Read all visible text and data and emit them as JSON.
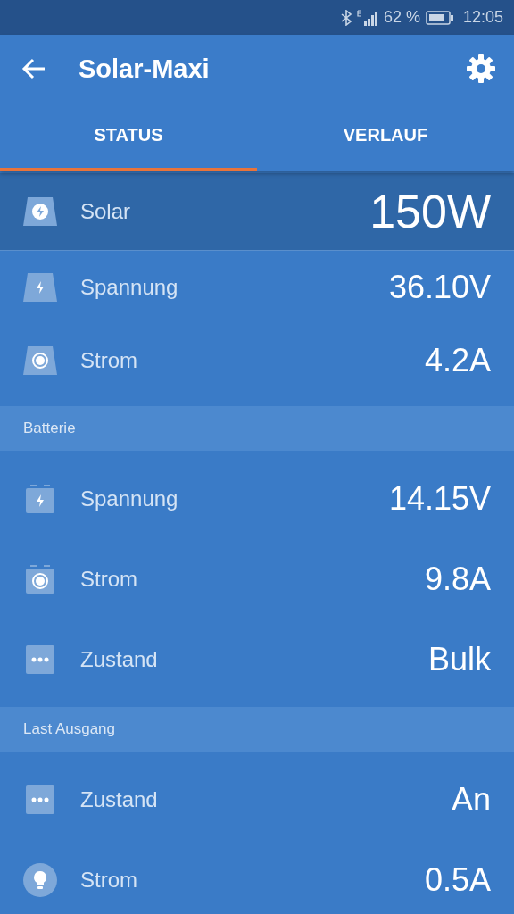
{
  "status_bar": {
    "battery_percent": "62 %",
    "time": "12:05"
  },
  "app_bar": {
    "title": "Solar-Maxi"
  },
  "tabs": [
    {
      "label": "STATUS",
      "selected": true
    },
    {
      "label": "VERLAUF",
      "selected": false
    }
  ],
  "sections": [
    {
      "rows": [
        {
          "kind": "panel-bolt-circle",
          "label": "Solar",
          "value": "150W",
          "emphasized": true
        },
        {
          "kind": "panel-bolt",
          "label": "Spannung",
          "value": "36.10V",
          "emphasized": false
        },
        {
          "kind": "panel-dot",
          "label": "Strom",
          "value": "4.2A",
          "emphasized": false
        }
      ]
    },
    {
      "header": "Batterie",
      "rows": [
        {
          "kind": "battery-bolt",
          "label": "Spannung",
          "value": "14.15V",
          "emphasized": false
        },
        {
          "kind": "battery-dot",
          "label": "Strom",
          "value": "9.8A",
          "emphasized": false
        },
        {
          "kind": "dots",
          "label": "Zustand",
          "value": "Bulk",
          "emphasized": false
        }
      ]
    },
    {
      "header": "Last Ausgang",
      "rows": [
        {
          "kind": "dots",
          "label": "Zustand",
          "value": "An",
          "emphasized": false
        },
        {
          "kind": "bulb",
          "label": "Strom",
          "value": "0.5A",
          "emphasized": false
        }
      ]
    }
  ]
}
